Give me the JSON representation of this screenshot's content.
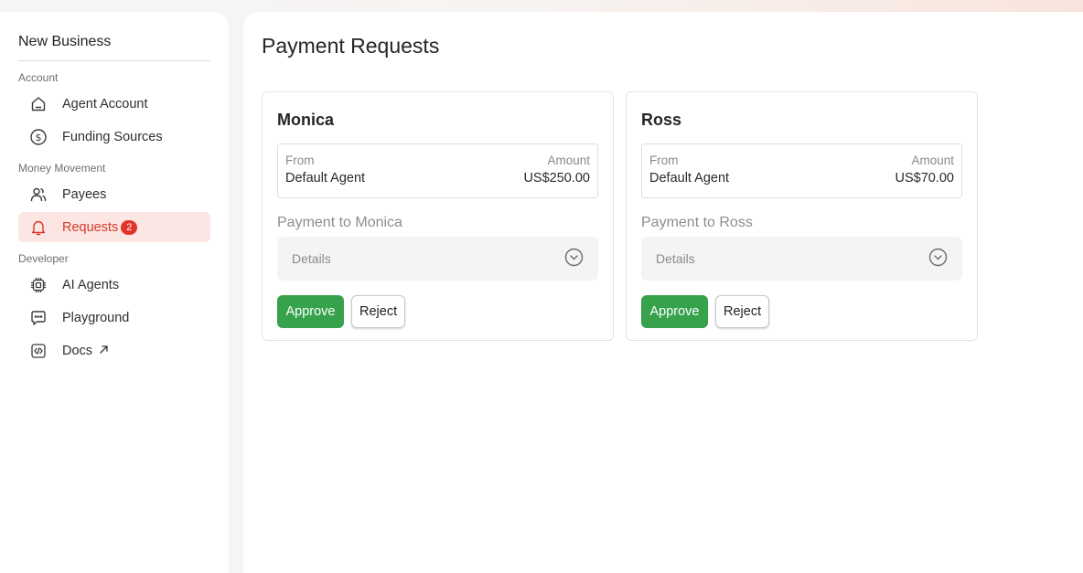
{
  "sidebar": {
    "brand": "New Business",
    "sections": {
      "account": "Account",
      "money_movement": "Money Movement",
      "developer": "Developer"
    },
    "items": {
      "agent_account": "Agent Account",
      "funding_sources": "Funding Sources",
      "payees": "Payees",
      "requests": "Requests",
      "requests_badge": "2",
      "ai_agents": "AI Agents",
      "playground": "Playground",
      "docs": "Docs"
    },
    "active_item": "requests",
    "icons": {
      "agent_account": "home-icon",
      "funding_sources": "dollar-circle-icon",
      "payees": "users-icon",
      "requests": "bell-icon",
      "ai_agents": "chip-icon",
      "playground": "chat-bubble-icon",
      "docs": "code-file-icon",
      "docs_external": "arrow-up-right-icon"
    }
  },
  "main": {
    "title": "Payment Requests",
    "requests": [
      {
        "name": "Monica",
        "from_label": "From",
        "from_value": "Default Agent",
        "amount_label": "Amount",
        "amount_value": "US$250.00",
        "description": "Payment to Monica",
        "details_label": "Details",
        "approve_label": "Approve",
        "reject_label": "Reject"
      },
      {
        "name": "Ross",
        "from_label": "From",
        "from_value": "Default Agent",
        "amount_label": "Amount",
        "amount_value": "US$70.00",
        "description": "Payment to Ross",
        "details_label": "Details",
        "approve_label": "Approve",
        "reject_label": "Reject"
      }
    ]
  },
  "colors": {
    "accent_red": "#d9382c",
    "active_bg": "#fbe6e3",
    "approve_green": "#36a24b",
    "badge_red": "#e0362a"
  }
}
